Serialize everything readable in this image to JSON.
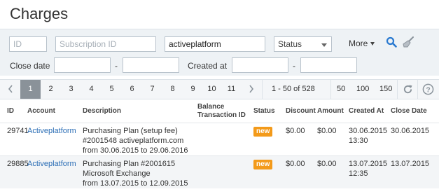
{
  "page": {
    "title": "Charges"
  },
  "filters": {
    "id_placeholder": "ID",
    "subscription_placeholder": "Subscription ID",
    "account_value": "activeplatform",
    "status_label": "Status",
    "more_label": "More",
    "close_date_label": "Close date",
    "created_at_label": "Created at",
    "range_separator": "-"
  },
  "pagination": {
    "pages": [
      "1",
      "2",
      "3",
      "4",
      "5",
      "6",
      "7",
      "8",
      "9",
      "10",
      "11"
    ],
    "current_page": "1",
    "range_text": "1 - 50 of 528",
    "per_page_options": [
      "50",
      "100",
      "150"
    ]
  },
  "table": {
    "columns": {
      "id": "ID",
      "account": "Account",
      "description": "Description",
      "balance_tx": "Balance Transaction ID",
      "status": "Status",
      "discount": "Discount",
      "amount": "Amount",
      "created_at": "Created At",
      "close_date": "Close Date"
    },
    "rows": [
      {
        "id": "29741",
        "account": "Activeplatform",
        "description_line1": "Purchasing Plan (setup fee)",
        "description_line2": "#2001548  activeplatform.com",
        "description_line3": "from 30.06.2015 to 29.06.2016",
        "balance_tx": "",
        "status": "new",
        "discount": "$0.00",
        "amount": "$0.00",
        "created_date": "30.06.2015",
        "created_time": "13:30",
        "close_date": "30.06.2015"
      },
      {
        "id": "29885",
        "account": "Activeplatform",
        "description_line1": "Purchasing Plan #2001615",
        "description_line2": "Microsoft Exchange",
        "description_line3": "from 13.07.2015 to 12.09.2015",
        "balance_tx": "",
        "status": "new",
        "discount": "$0.00",
        "amount": "$0.00",
        "created_date": "13.07.2015",
        "created_time": "12:35",
        "close_date": "13.07.2015"
      }
    ]
  },
  "colors": {
    "status_new": "#f39a1a",
    "link": "#2a6db5",
    "active_page": "#8a9299",
    "search_icon": "#2a7ad0"
  },
  "icons": [
    "search-icon",
    "clear-filter-icon",
    "chevron-left-icon",
    "chevron-right-icon",
    "refresh-icon",
    "help-icon"
  ]
}
